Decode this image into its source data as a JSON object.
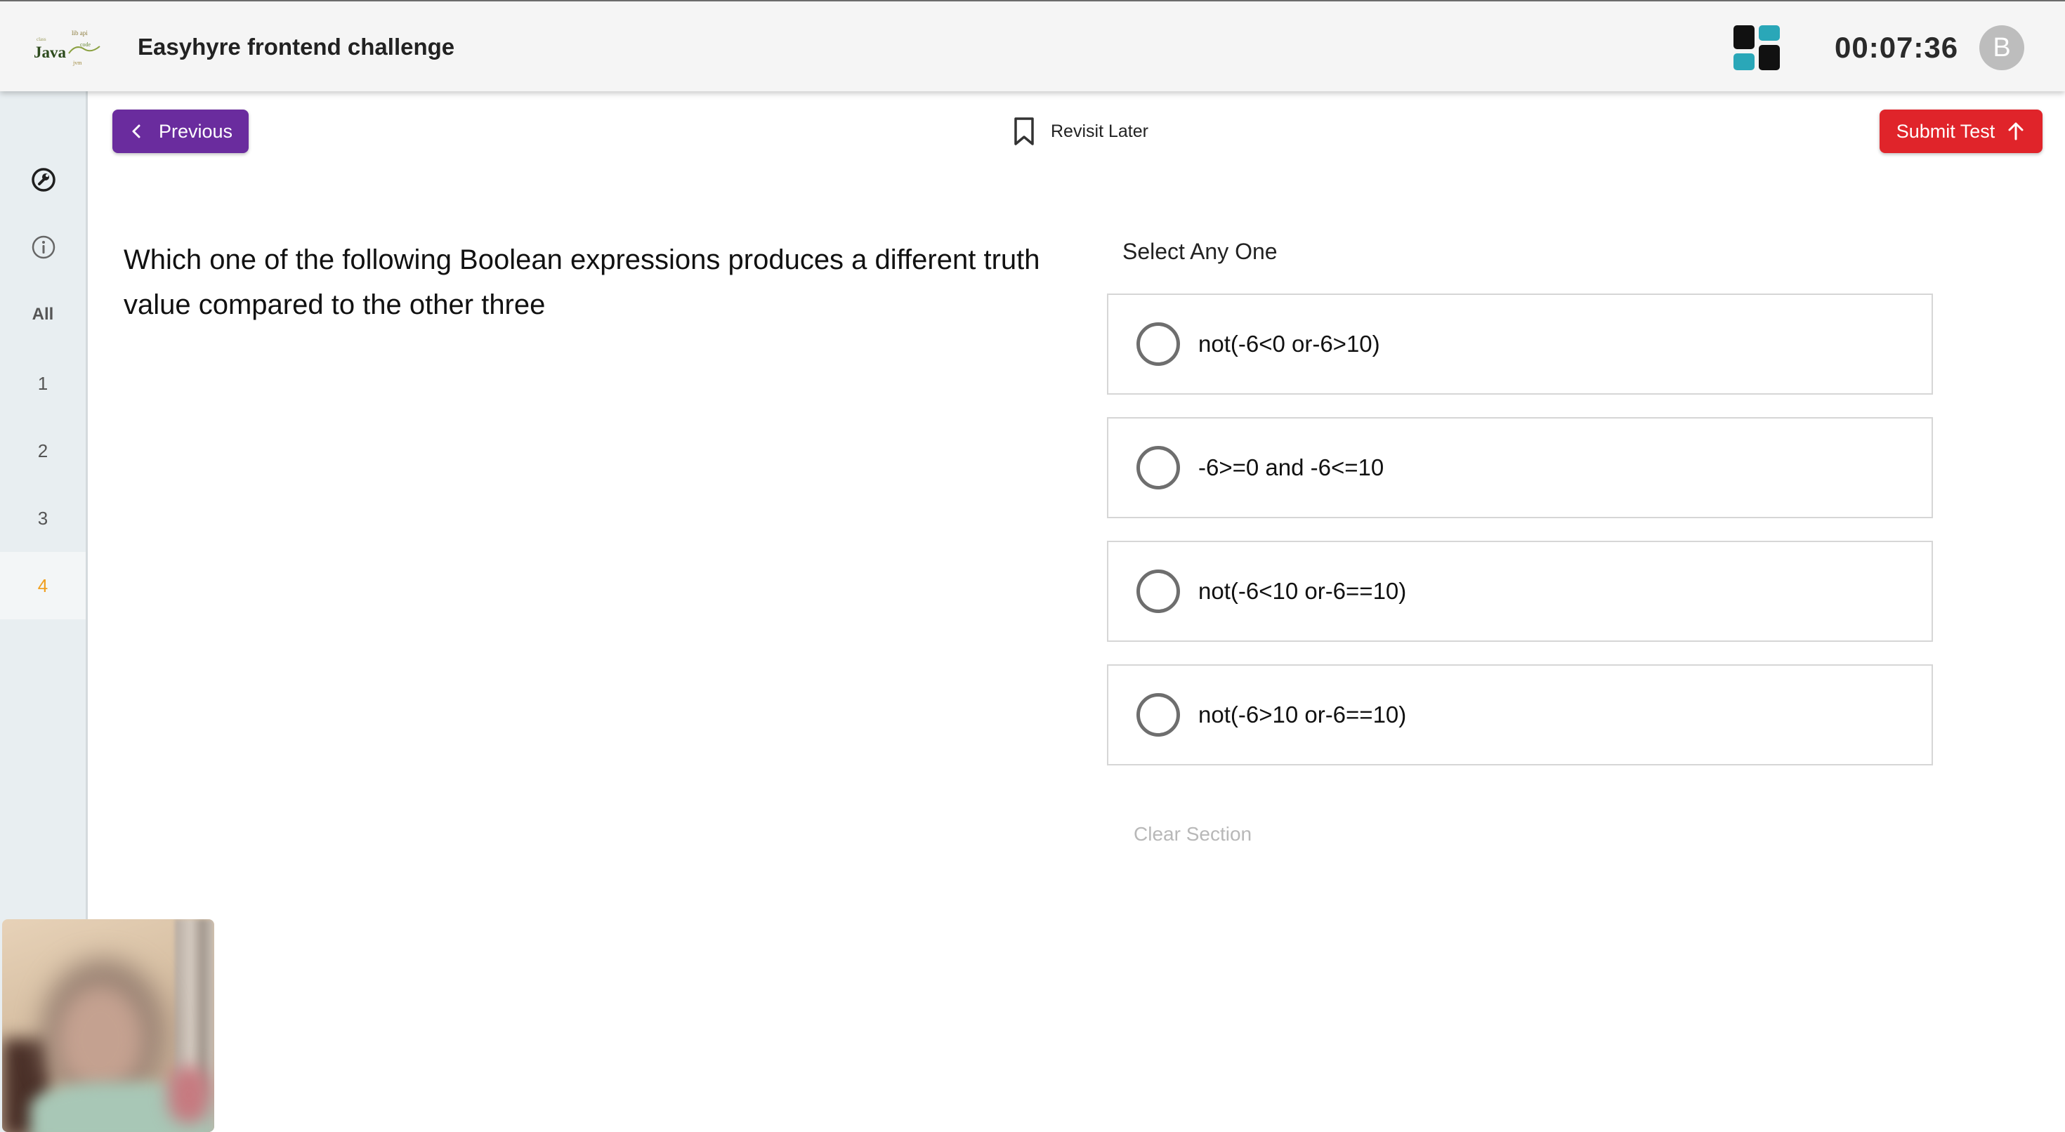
{
  "header": {
    "logo_text": "Java",
    "title": "Easyhyre frontend challenge",
    "timer": "00:07:36",
    "avatar_initial": "B",
    "grid_colors": [
      "#111111",
      "#2aa7b8",
      "#2aa7b8",
      "#111111"
    ]
  },
  "sidebar": {
    "icons": [
      "wrench-icon",
      "info-icon"
    ],
    "items": [
      {
        "label": "All"
      },
      {
        "label": "1"
      },
      {
        "label": "2"
      },
      {
        "label": "3"
      },
      {
        "label": "4"
      }
    ],
    "active_item": "4"
  },
  "toolbar": {
    "previous_label": "Previous",
    "revisit_label": "Revisit Later",
    "submit_label": "Submit Test"
  },
  "question": {
    "text": "Which one of the following Boolean expressions produces a different truth value compared to the other three",
    "select_label": "Select Any One",
    "options": [
      {
        "text": "not(-6<0 or-6>10)"
      },
      {
        "text": "-6>=0 and -6<=10"
      },
      {
        "text": "not(-6<10 or-6==10)"
      },
      {
        "text": "not(-6>10 or-6==10)"
      }
    ],
    "clear_label": "Clear Section"
  },
  "colors": {
    "previous_button": "#6a2c9e",
    "submit_button": "#e0242a",
    "active_question": "#f0a020",
    "sidebar_bg": "#e8eef1"
  }
}
